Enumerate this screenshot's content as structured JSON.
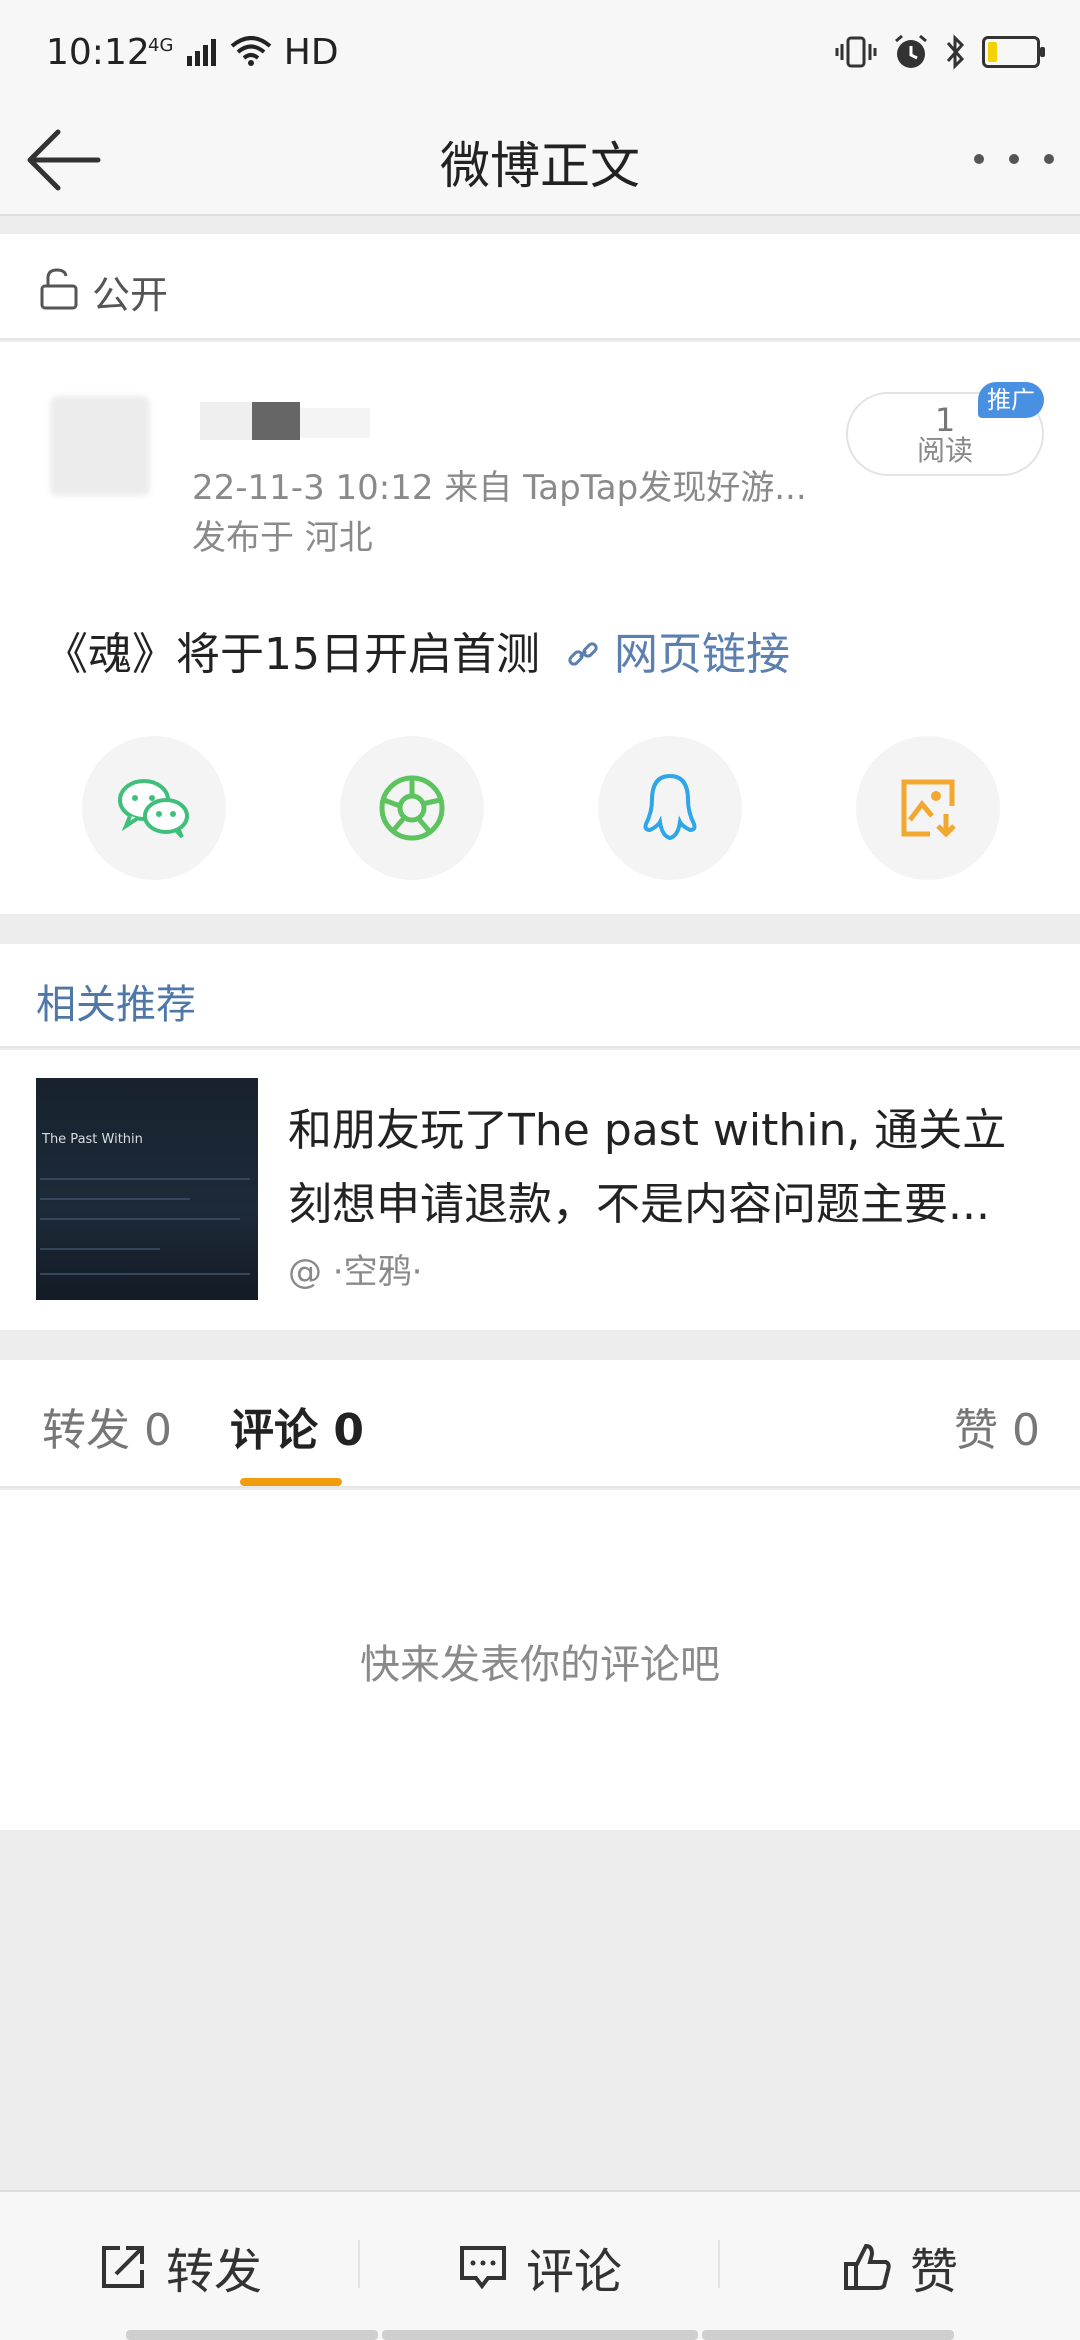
{
  "status_bar": {
    "time": "10:12",
    "network": "4G",
    "hd": "HD",
    "battery_level": 0.2
  },
  "nav": {
    "title": "微博正文"
  },
  "visibility": {
    "label": "公开"
  },
  "post": {
    "meta": "22-11-3 10:12  来自 TapTap发现好游...",
    "location": "发布于 河北",
    "read_count": "1",
    "read_label": "阅读",
    "promo_badge": "推广",
    "text": "《魂》将于15日开启首测",
    "link_text": "网页链接"
  },
  "share": [
    {
      "name": "wechat-icon",
      "color": "#3fbf7a"
    },
    {
      "name": "moments-icon",
      "color": "#5cc35e"
    },
    {
      "name": "qq-icon",
      "color": "#2ea6e8"
    },
    {
      "name": "save-image-icon",
      "color": "#f2a72f"
    }
  ],
  "related": {
    "title": "相关推荐",
    "thumb_title": "The Past Within",
    "line1": "和朋友玩了The past within, 通关立",
    "line2": "刻想申请退款，不是内容问题主要...",
    "author": "@ ·空鸦·"
  },
  "tabs": {
    "repost": "转发 0",
    "comment": "评论 0",
    "like": "赞 0"
  },
  "empty": {
    "text": "快来发表你的评论吧"
  },
  "bottom": {
    "repost": "转发",
    "comment": "评论",
    "like": "赞"
  }
}
